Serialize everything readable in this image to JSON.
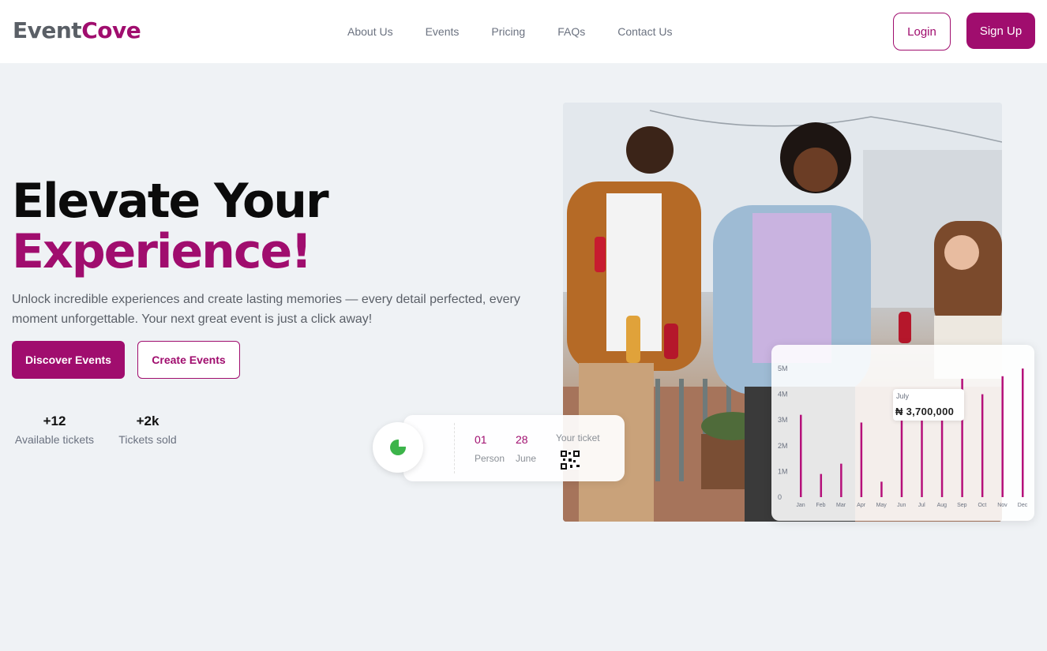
{
  "header": {
    "logo_part1": "Event",
    "logo_part2": "Cove",
    "nav": [
      "About Us",
      "Events",
      "Pricing",
      "FAQs",
      "Contact Us"
    ],
    "login_label": "Login",
    "signup_label": "Sign Up"
  },
  "hero": {
    "title_line1": "Elevate Your",
    "title_line2": "Experience!",
    "subtitle": "Unlock incredible experiences and create lasting memories — every detail perfected, every moment unforgettable. Your next great event is just a click away!",
    "discover_label": "Discover Events",
    "create_label": "Create Events",
    "stats": [
      {
        "value": "+12",
        "label": "Available tickets"
      },
      {
        "value": "+2k",
        "label": "Tickets sold"
      }
    ]
  },
  "ticket": {
    "person_value": "01",
    "person_label": "Person",
    "date_value": "28",
    "date_label": "June",
    "title": "Your ticket"
  },
  "chart_data": {
    "type": "bar",
    "categories": [
      "Jan",
      "Feb",
      "Mar",
      "Apr",
      "May",
      "Jun",
      "Jul",
      "Aug",
      "Sep",
      "Oct",
      "Nov",
      "Dec"
    ],
    "values": [
      3200000,
      900000,
      1300000,
      2900000,
      600000,
      3000000,
      3700000,
      3100000,
      4600000,
      4000000,
      4700000,
      5000000
    ],
    "ytick_labels": [
      "0",
      "1M",
      "2M",
      "3M",
      "4M",
      "5M"
    ],
    "ylim": [
      0,
      5000000
    ],
    "bar_color": "#b5107a",
    "tooltip": {
      "month": "July",
      "amount": "₦ 3,700,000"
    }
  },
  "colors": {
    "accent": "#a00d6e",
    "background": "#eff2f5"
  }
}
